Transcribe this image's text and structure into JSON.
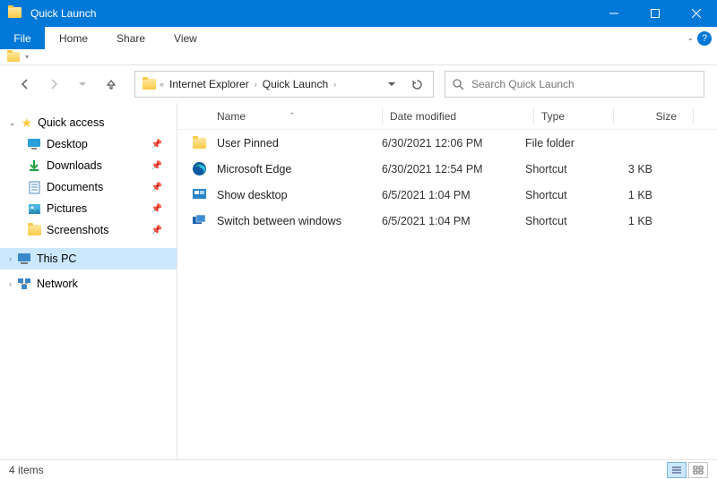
{
  "window": {
    "title": "Quick Launch"
  },
  "ribbon": {
    "file": "File",
    "tabs": [
      "Home",
      "Share",
      "View"
    ]
  },
  "breadcrumb": {
    "items": [
      "Internet Explorer",
      "Quick Launch"
    ]
  },
  "search": {
    "placeholder": "Search Quick Launch"
  },
  "sidebar": {
    "quick_access": "Quick access",
    "items": [
      {
        "label": "Desktop",
        "icon": "desktop"
      },
      {
        "label": "Downloads",
        "icon": "downloads"
      },
      {
        "label": "Documents",
        "icon": "documents"
      },
      {
        "label": "Pictures",
        "icon": "pictures"
      },
      {
        "label": "Screenshots",
        "icon": "folder"
      }
    ],
    "this_pc": "This PC",
    "network": "Network"
  },
  "columns": {
    "name": "Name",
    "date": "Date modified",
    "type": "Type",
    "size": "Size"
  },
  "files": [
    {
      "name": "User Pinned",
      "date": "6/30/2021 12:06 PM",
      "type": "File folder",
      "size": "",
      "icon": "folder"
    },
    {
      "name": "Microsoft Edge",
      "date": "6/30/2021 12:54 PM",
      "type": "Shortcut",
      "size": "3 KB",
      "icon": "edge"
    },
    {
      "name": "Show desktop",
      "date": "6/5/2021 1:04 PM",
      "type": "Shortcut",
      "size": "1 KB",
      "icon": "showdesktop"
    },
    {
      "name": "Switch between windows",
      "date": "6/5/2021 1:04 PM",
      "type": "Shortcut",
      "size": "1 KB",
      "icon": "switch"
    }
  ],
  "status": {
    "count": "4 items"
  }
}
